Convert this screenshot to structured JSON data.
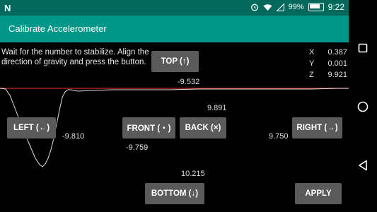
{
  "status_bar": {
    "notification_icon": "N",
    "battery_percent": "99%",
    "time": "9:22"
  },
  "app": {
    "title": "Calibrate Accelerometer"
  },
  "instructions": "Wait for the number to stabilize. Align the direction of gravity and press the button.",
  "readout": {
    "x_label": "X",
    "x_value": "0.387",
    "y_label": "Y",
    "y_value": "0.001",
    "z_label": "Z",
    "z_value": "9.921"
  },
  "buttons": {
    "top": "TOP (↑)",
    "left": "LEFT (←)",
    "front": "FRONT (・)",
    "back": "BACK (×)",
    "right": "RIGHT (→)",
    "bottom": "BOTTOM (↓)",
    "apply": "APPLY"
  },
  "values": {
    "top": "-9.532",
    "left": "-9.810",
    "front": "-9.759",
    "back": "9.891",
    "right": "9.750",
    "bottom": "10.215"
  },
  "colors": {
    "status_bar": "#00695c",
    "action_bar": "#009688",
    "reference_line": "#c62828",
    "trace": "#e0e0e0"
  }
}
